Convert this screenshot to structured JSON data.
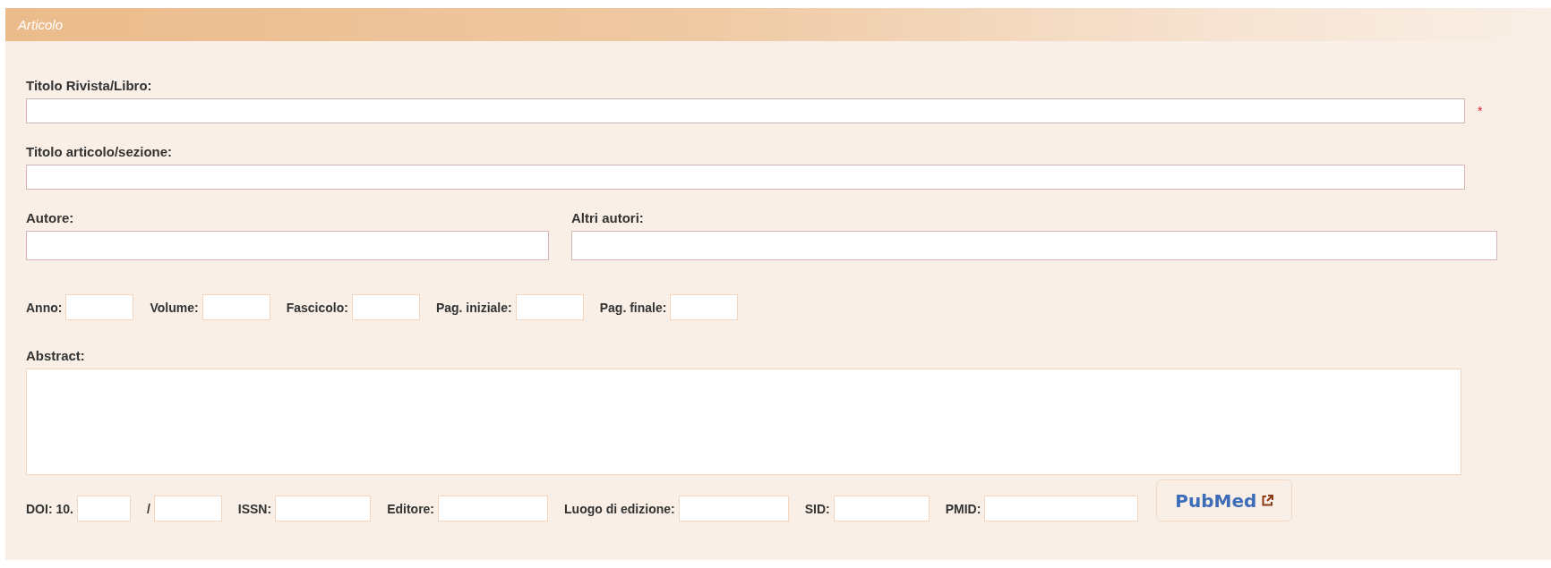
{
  "section": {
    "title": "Articolo"
  },
  "rows": [
    {
      "kind": "wide",
      "fields": [
        {
          "label": "Titolo Rivista/Libro:",
          "required_mark": "*"
        }
      ]
    },
    {
      "kind": "wide",
      "fields": [
        {
          "label": "Titolo articolo/sezione:"
        }
      ]
    },
    {
      "kind": "pair",
      "fields": [
        {
          "label": "Autore:"
        },
        {
          "label": "Altri autori:"
        }
      ]
    },
    {
      "kind": "inline",
      "fields": [
        {
          "label": "Anno:"
        },
        {
          "label": "Volume:"
        },
        {
          "label": "Fascicolo:"
        },
        {
          "label": "Pag. iniziale:"
        },
        {
          "label": "Pag. finale:"
        }
      ]
    },
    {
      "kind": "textarea",
      "fields": [
        {
          "label": "Abstract:"
        }
      ]
    },
    {
      "kind": "inline",
      "fields": [
        {
          "label": "DOI: 10."
        },
        {
          "label": "/"
        },
        {
          "label": "ISSN:"
        },
        {
          "label": "Editore:"
        },
        {
          "label": "Luogo di edizione:"
        },
        {
          "label": "SID:"
        },
        {
          "label": "PMID:"
        }
      ],
      "button": {
        "label": "PubMed"
      }
    }
  ]
}
